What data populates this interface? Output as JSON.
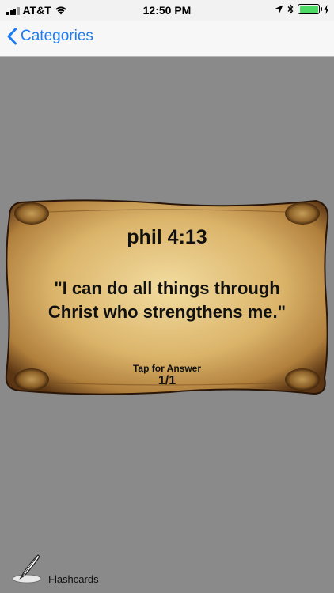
{
  "status_bar": {
    "carrier": "AT&T",
    "time": "12:50 PM",
    "battery_color": "#4cd964"
  },
  "nav": {
    "back_label": "Categories",
    "accent_color": "#1a7cf5"
  },
  "card": {
    "title": "phil 4:13",
    "verse": "\"I can do all things through Christ who strengthens me.\"",
    "hint": "Tap for Answer",
    "counter": "1/1"
  },
  "tab_bar": {
    "items": [
      {
        "label": "Flashcards",
        "icon": "quill-pen-icon",
        "selected": true
      }
    ]
  }
}
